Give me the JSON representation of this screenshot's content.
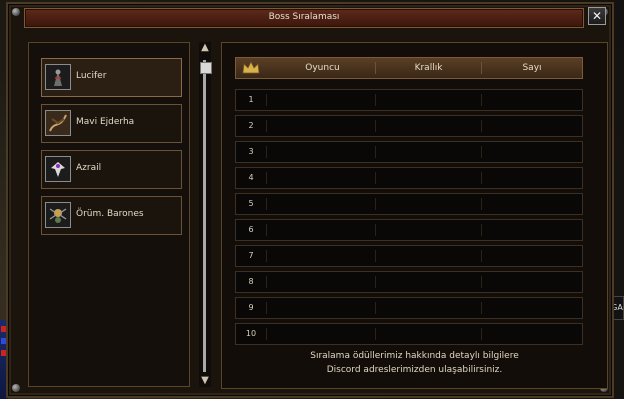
{
  "window": {
    "title": "Boss Sıralaması",
    "close_label": "✕"
  },
  "bosses": [
    {
      "name": "Lucifer",
      "icon": "lucifer-portrait-icon"
    },
    {
      "name": "Mavi Ejderha",
      "icon": "blue-dragon-portrait-icon"
    },
    {
      "name": "Azrail",
      "icon": "azrail-portrait-icon"
    },
    {
      "name": "Örüm. Barones",
      "icon": "spider-baroness-portrait-icon"
    }
  ],
  "table": {
    "columns": [
      "Oyuncu",
      "Krallık",
      "Sayı"
    ],
    "rows": [
      "1",
      "2",
      "3",
      "4",
      "5",
      "6",
      "7",
      "8",
      "9",
      "10"
    ]
  },
  "footer": {
    "line1": "Sıralama ödüllerimiz hakkında detaylı bilgilere",
    "line2": "Discord adreslerimizden ulaşabilirsiniz."
  },
  "side_tab": "GA",
  "colors": {
    "accent": "#5e2a1a",
    "border": "#7a5a38",
    "text": "#e2d8c5"
  }
}
